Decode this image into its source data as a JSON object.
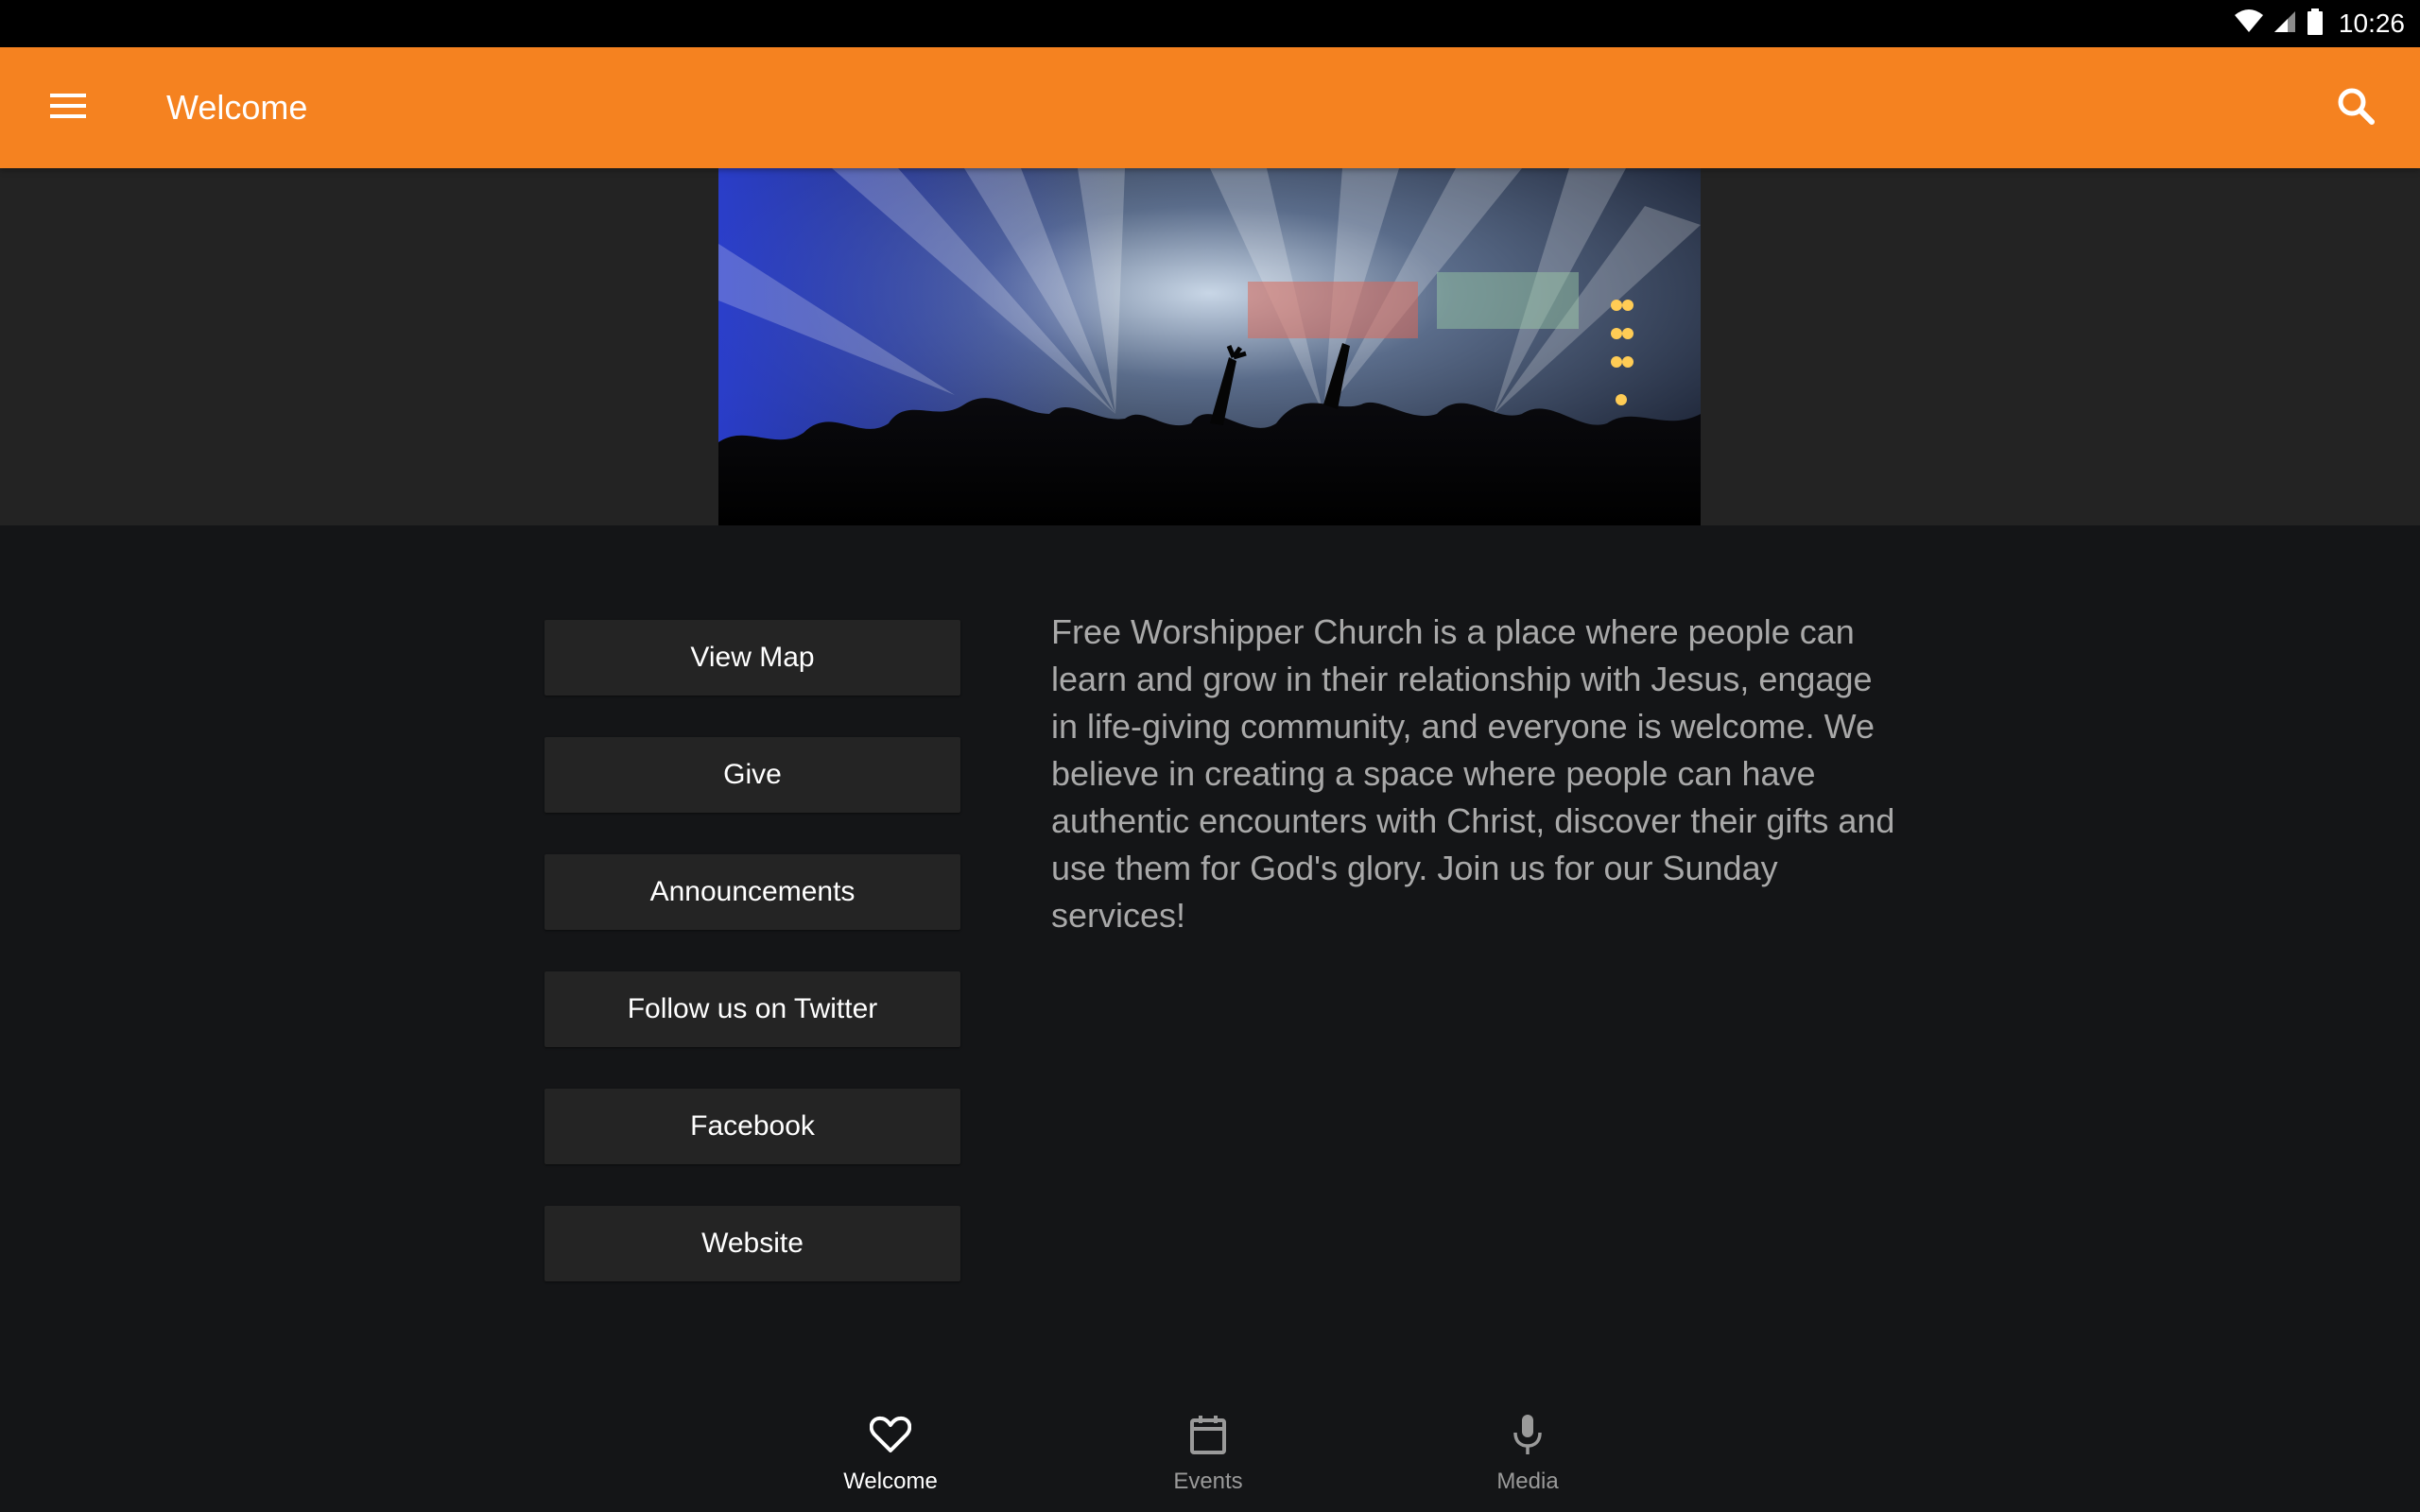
{
  "status_bar": {
    "time": "10:26",
    "icons": [
      "wifi-icon",
      "cell-signal-icon",
      "battery-icon"
    ]
  },
  "app_bar": {
    "title": "Welcome",
    "menu_icon": "hamburger-menu-icon",
    "search_icon": "search-icon",
    "color": "#f58220"
  },
  "hero": {
    "image": "concert-crowd-stage-lights"
  },
  "buttons": [
    {
      "label": "View Map"
    },
    {
      "label": "Give"
    },
    {
      "label": "Announcements"
    },
    {
      "label": "Follow us on Twitter"
    },
    {
      "label": "Facebook"
    },
    {
      "label": "Website"
    }
  ],
  "description": "Free Worshipper Church is a place where people can learn and grow in their relationship with Jesus, engage in life-giving community, and everyone is welcome. We believe in creating a space where people can have authentic encounters with Christ, discover their gifts and use them for God's glory. Join us for our Sunday services!",
  "bottom_nav": {
    "items": [
      {
        "label": "Welcome",
        "icon": "heart-icon",
        "active": true
      },
      {
        "label": "Events",
        "icon": "calendar-icon",
        "active": false
      },
      {
        "label": "Media",
        "icon": "microphone-icon",
        "active": false
      }
    ]
  }
}
